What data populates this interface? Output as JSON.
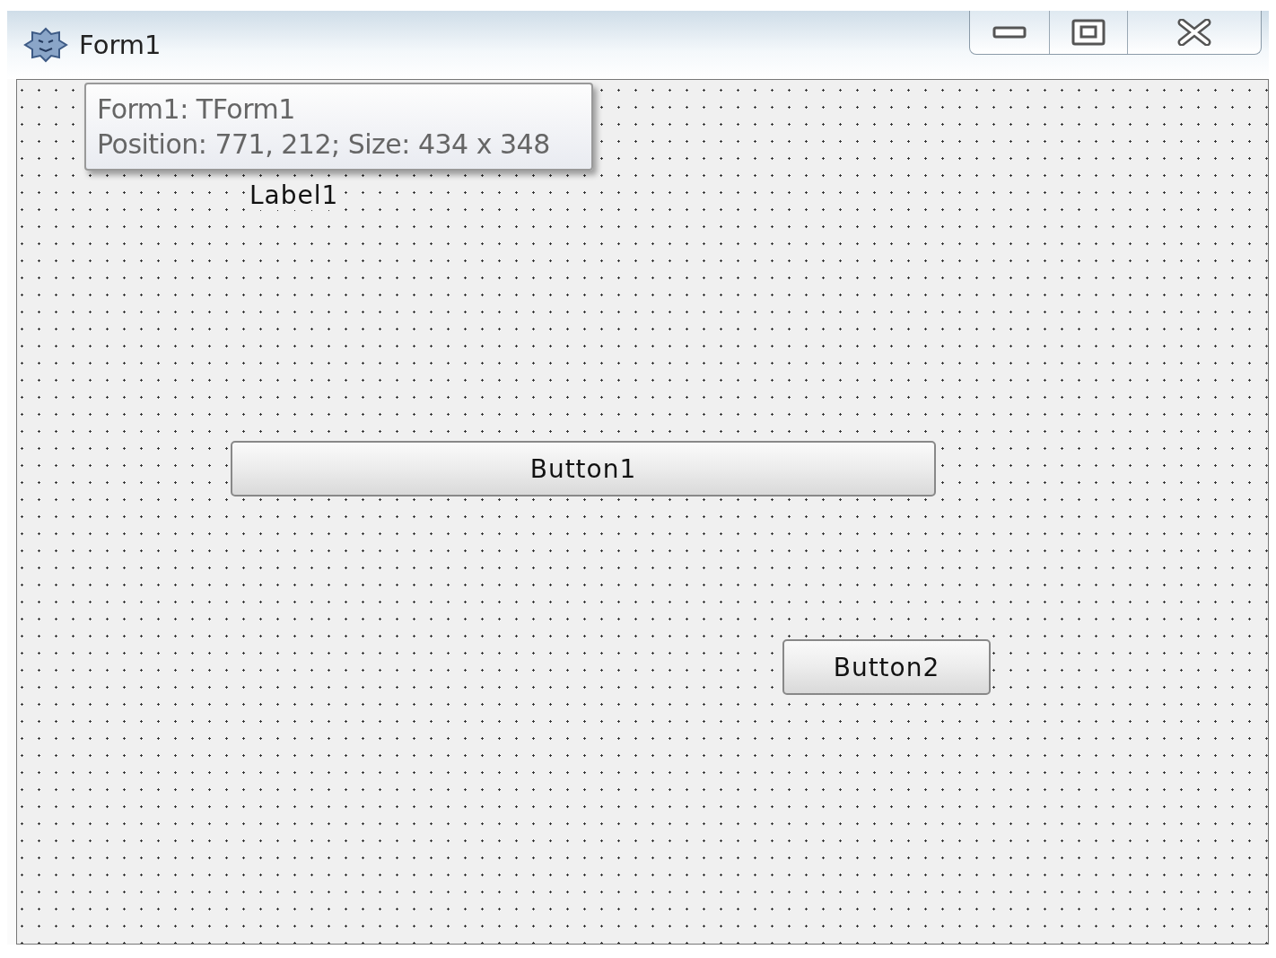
{
  "window": {
    "title": "Form1"
  },
  "tooltip": {
    "lines": [
      "Form1: TForm1",
      "Position: 771, 212; Size: 434 x 348"
    ]
  },
  "form": {
    "controls": [
      {
        "kind": "label",
        "text": "Label1"
      },
      {
        "kind": "button",
        "text": "Button1"
      },
      {
        "kind": "button",
        "text": "Button2"
      }
    ]
  }
}
